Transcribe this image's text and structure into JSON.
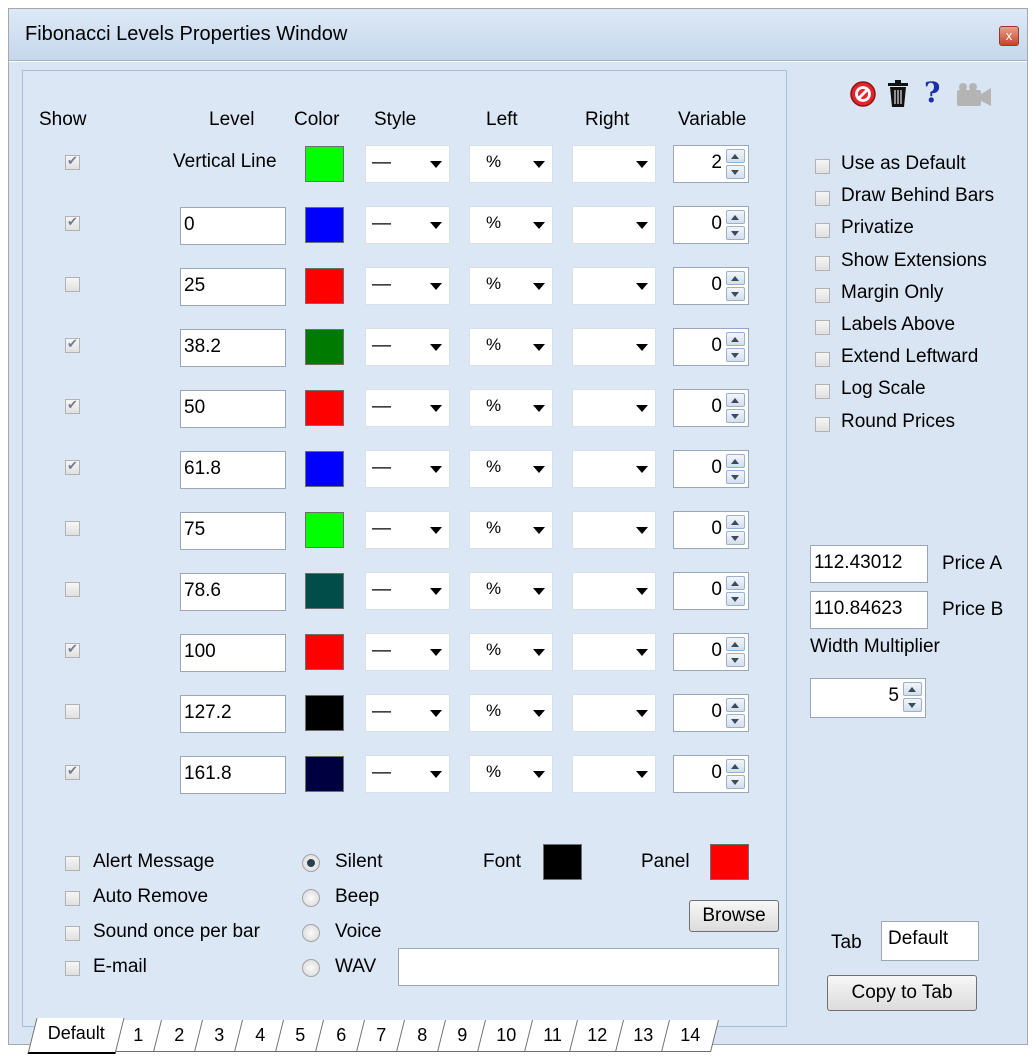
{
  "window": {
    "title": "Fibonacci Levels Properties Window",
    "close_label": "x"
  },
  "headers": {
    "show": "Show",
    "level": "Level",
    "color": "Color",
    "style": "Style",
    "left": "Left",
    "right": "Right",
    "variable": "Variable"
  },
  "rows": [
    {
      "show": true,
      "level": "Vertical Line",
      "level_is_label": true,
      "color": "#00ff00",
      "style": "—",
      "left": "%",
      "right": "",
      "variable": "2"
    },
    {
      "show": true,
      "level": "0",
      "color": "#0000ff",
      "style": "—",
      "left": "%",
      "right": "",
      "variable": "0"
    },
    {
      "show": false,
      "level": "25",
      "color": "#ff0000",
      "style": "—",
      "left": "%",
      "right": "",
      "variable": "0"
    },
    {
      "show": true,
      "level": "38.2",
      "color": "#007a00",
      "style": "—",
      "left": "%",
      "right": "",
      "variable": "0"
    },
    {
      "show": true,
      "level": "50",
      "color": "#ff0000",
      "style": "—",
      "left": "%",
      "right": "",
      "variable": "0"
    },
    {
      "show": true,
      "level": "61.8",
      "color": "#0000ff",
      "style": "—",
      "left": "%",
      "right": "",
      "variable": "0"
    },
    {
      "show": false,
      "level": "75",
      "color": "#00ff00",
      "style": "—",
      "left": "%",
      "right": "",
      "variable": "0"
    },
    {
      "show": false,
      "level": "78.6",
      "color": "#004d4a",
      "style": "—",
      "left": "%",
      "right": "",
      "variable": "0"
    },
    {
      "show": true,
      "level": "100",
      "color": "#ff0000",
      "style": "—",
      "left": "%",
      "right": "",
      "variable": "0"
    },
    {
      "show": false,
      "level": "127.2",
      "color": "#000000",
      "style": "—",
      "left": "%",
      "right": "",
      "variable": "0"
    },
    {
      "show": true,
      "level": "161.8",
      "color": "#000040",
      "style": "—",
      "left": "%",
      "right": "",
      "variable": "0"
    }
  ],
  "alerts": {
    "alert_message": {
      "label": "Alert Message",
      "checked": false
    },
    "auto_remove": {
      "label": "Auto Remove",
      "checked": false
    },
    "sound_once": {
      "label": "Sound once per bar",
      "checked": false
    },
    "email": {
      "label": "E-mail",
      "checked": false
    }
  },
  "sound": {
    "silent": {
      "label": "Silent",
      "selected": true
    },
    "beep": {
      "label": "Beep",
      "selected": false
    },
    "voice": {
      "label": "Voice",
      "selected": false
    },
    "wav": {
      "label": "WAV",
      "selected": false
    },
    "wav_path": ""
  },
  "font": {
    "label": "Font",
    "color": "#000000"
  },
  "panel": {
    "label": "Panel",
    "color": "#ff0000"
  },
  "browse_label": "Browse",
  "tabs": [
    "Default",
    "1",
    "2",
    "3",
    "4",
    "5",
    "6",
    "7",
    "8",
    "9",
    "10",
    "11",
    "12",
    "13",
    "14"
  ],
  "active_tab": "Default",
  "toolbar_icons": [
    "cancel-icon",
    "trash-icon",
    "help-icon",
    "camera-icon"
  ],
  "options": [
    {
      "label": "Use as Default",
      "checked": false
    },
    {
      "label": "Draw Behind Bars",
      "checked": false
    },
    {
      "label": "Privatize",
      "checked": false
    },
    {
      "label": "Show Extensions",
      "checked": false
    },
    {
      "label": "Margin Only",
      "checked": false
    },
    {
      "label": "Labels Above",
      "checked": false
    },
    {
      "label": "Extend Leftward",
      "checked": false
    },
    {
      "label": "Log Scale",
      "checked": false
    },
    {
      "label": "Round Prices",
      "checked": false
    }
  ],
  "price_a": {
    "value": "112.43012",
    "label": "Price A"
  },
  "price_b": {
    "value": "110.84623",
    "label": "Price B"
  },
  "width_multiplier": {
    "label": "Width Multiplier",
    "value": "5"
  },
  "tab_name": {
    "label": "Tab",
    "value": "Default"
  },
  "copy_to_tab_label": "Copy to Tab"
}
